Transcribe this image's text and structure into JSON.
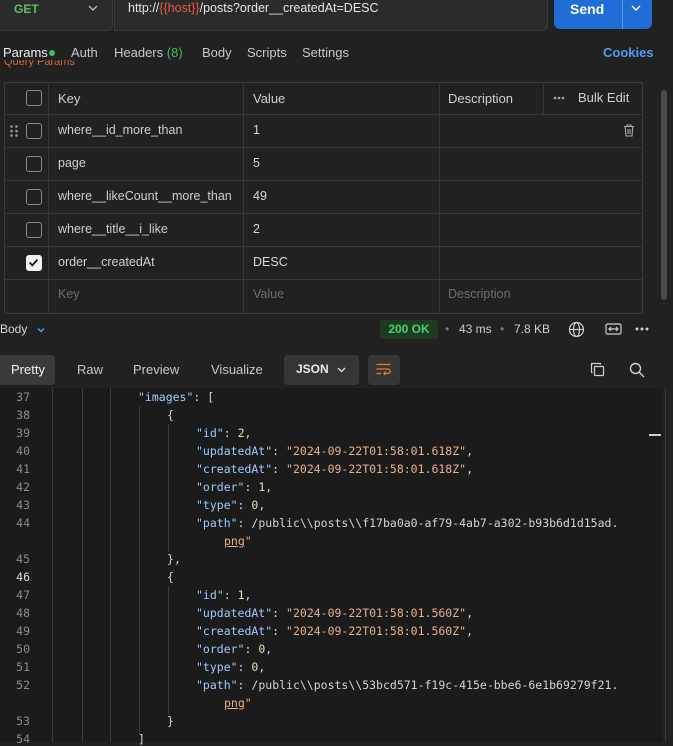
{
  "request": {
    "method": "GET",
    "url_prefix": "http://",
    "url_var": "{{host}}",
    "url_suffix": "/posts?order__createdAt=DESC",
    "send_label": "Send"
  },
  "tabs": [
    {
      "label": "Params"
    },
    {
      "label": "Auth"
    },
    {
      "label": "Headers",
      "count": "(8)"
    },
    {
      "label": "Body"
    },
    {
      "label": "Scripts"
    },
    {
      "label": "Settings"
    }
  ],
  "cookies_label": "Cookies",
  "section_label_cut": "Query Params",
  "params": {
    "headers": {
      "key": "Key",
      "value": "Value",
      "description": "Description",
      "bulk_edit": "Bulk Edit"
    },
    "rows": [
      {
        "key": "where__id_more_than",
        "value": "1",
        "checked": false
      },
      {
        "key": "page",
        "value": "5",
        "checked": false
      },
      {
        "key": "where__likeCount__more_than",
        "value": "49",
        "checked": false
      },
      {
        "key": "where__title__i_like",
        "value": "2",
        "checked": false
      },
      {
        "key": "order__createdAt",
        "value": "DESC",
        "checked": true
      }
    ],
    "placeholder": {
      "key": "Key",
      "value": "Value",
      "description": "Description"
    }
  },
  "response": {
    "body_label": "Body",
    "status": "200 OK",
    "time": "43 ms",
    "size": "7.8 KB"
  },
  "view_tabs": [
    "Pretty",
    "Raw",
    "Preview",
    "Visualize"
  ],
  "format_label": "JSON",
  "code": {
    "line_numbers": [
      "37",
      "38",
      "39",
      "40",
      "41",
      "42",
      "43",
      "44",
      "",
      "45",
      "46",
      "47",
      "48",
      "49",
      "50",
      "51",
      "52",
      "",
      "53",
      "54"
    ],
    "lines": [
      "\"images\": [",
      "{",
      "\"id\": 2,",
      "\"updatedAt\": \"2024-09-22T01:58:01.618Z\",",
      "\"createdAt\": \"2024-09-22T01:58:01.618Z\",",
      "\"order\": 1,",
      "\"type\": 0,",
      "\"path\": \"/public\\\\posts\\\\f17ba0a0-af79-4ab7-a302-b93b6d1d15ad.",
      "png\"",
      "},",
      "{",
      "\"id\": 1,",
      "\"updatedAt\": \"2024-09-22T01:58:01.560Z\",",
      "\"createdAt\": \"2024-09-22T01:58:01.560Z\",",
      "\"order\": 0,",
      "\"type\": 0,",
      "\"path\": \"/public\\\\posts\\\\53bcd571-f19c-415e-bbe6-6e1b69279f21.",
      "png\"",
      "}",
      "]"
    ]
  },
  "colors": {
    "accent": "#1f6ed6",
    "method": "#5fbf63",
    "status_ok": "#49d070",
    "url_variable": "#e45a3f",
    "link": "#4f9df5"
  }
}
